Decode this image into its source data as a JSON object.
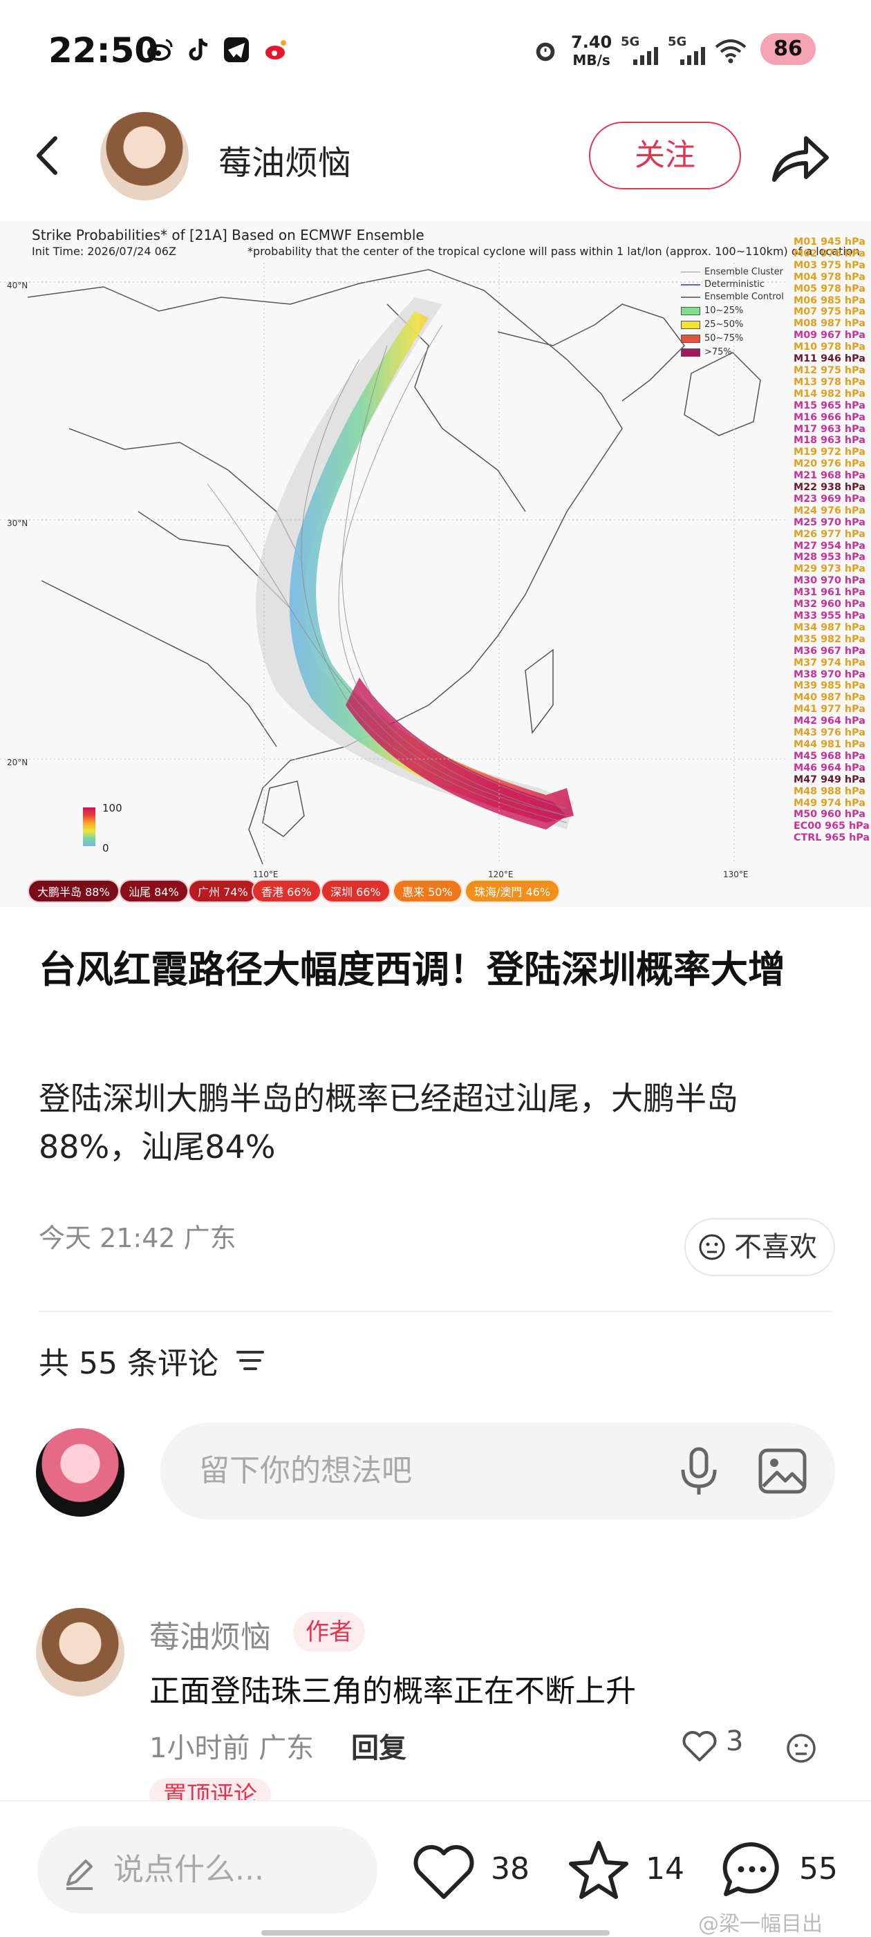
{
  "status_bar": {
    "time": "22:50",
    "net_speed_value": "7.40",
    "net_speed_unit": "MB/s",
    "signal1": "5G",
    "signal2": "5G",
    "battery": "86",
    "app_icons": [
      "weibo-icon",
      "tiktok-icon",
      "telegram-icon",
      "weibo-icon"
    ]
  },
  "header": {
    "author_name": "莓油烦恼",
    "follow_label": "关注"
  },
  "map": {
    "title": "Strike Probabilities* of [21A] Based on ECMWF Ensemble",
    "init_time": "Init Time: 2026/07/24 06Z",
    "note": "*probability that the center of the tropical cyclone will pass within 1 lat/lon (approx. 100~110km) of a location",
    "legend": [
      "Ensemble Cluster",
      "Deterministic",
      "Ensemble Control",
      "10~25%",
      "25~50%",
      "50~75%",
      ">75%"
    ],
    "legend_colors": [
      "#7fe08a",
      "#f2e23a",
      "#e8503c",
      "#a3195b"
    ],
    "lat_labels": [
      "40°N",
      "30°N",
      "20°N"
    ],
    "lon_labels": [
      "110°E",
      "120°E",
      "130°E"
    ],
    "scale_top": "100",
    "scale_bottom": "0",
    "members": [
      {
        "label": "M01 945 hPa",
        "color": "#e0a020"
      },
      {
        "label": "M02 976 hPa",
        "color": "#e0a020"
      },
      {
        "label": "M03 975 hPa",
        "color": "#e0a020"
      },
      {
        "label": "M04 978 hPa",
        "color": "#e0a020"
      },
      {
        "label": "M05 978 hPa",
        "color": "#e0a020"
      },
      {
        "label": "M06 985 hPa",
        "color": "#e0a020"
      },
      {
        "label": "M07 975 hPa",
        "color": "#e0a020"
      },
      {
        "label": "M08 987 hPa",
        "color": "#e0a020"
      },
      {
        "label": "M09 967 hPa",
        "color": "#c8329a"
      },
      {
        "label": "M10 978 hPa",
        "color": "#e0a020"
      },
      {
        "label": "M11 946 hPa",
        "color": "#6a1a2a"
      },
      {
        "label": "M12 975 hPa",
        "color": "#e0a020"
      },
      {
        "label": "M13 978 hPa",
        "color": "#e0a020"
      },
      {
        "label": "M14 982 hPa",
        "color": "#e0a020"
      },
      {
        "label": "M15 965 hPa",
        "color": "#c8329a"
      },
      {
        "label": "M16 966 hPa",
        "color": "#c8329a"
      },
      {
        "label": "M17 963 hPa",
        "color": "#c8329a"
      },
      {
        "label": "M18 963 hPa",
        "color": "#c8329a"
      },
      {
        "label": "M19 972 hPa",
        "color": "#e0a020"
      },
      {
        "label": "M20 976 hPa",
        "color": "#e0a020"
      },
      {
        "label": "M21 968 hPa",
        "color": "#c8329a"
      },
      {
        "label": "M22 938 hPa",
        "color": "#6a1a2a"
      },
      {
        "label": "M23 969 hPa",
        "color": "#c8329a"
      },
      {
        "label": "M24 976 hPa",
        "color": "#e0a020"
      },
      {
        "label": "M25 970 hPa",
        "color": "#c8329a"
      },
      {
        "label": "M26 977 hPa",
        "color": "#e0a020"
      },
      {
        "label": "M27 954 hPa",
        "color": "#c8329a"
      },
      {
        "label": "M28 953 hPa",
        "color": "#c8329a"
      },
      {
        "label": "M29 973 hPa",
        "color": "#e0a020"
      },
      {
        "label": "M30 970 hPa",
        "color": "#c8329a"
      },
      {
        "label": "M31 961 hPa",
        "color": "#c8329a"
      },
      {
        "label": "M32 960 hPa",
        "color": "#c8329a"
      },
      {
        "label": "M33 955 hPa",
        "color": "#c8329a"
      },
      {
        "label": "M34 987 hPa",
        "color": "#e0a020"
      },
      {
        "label": "M35 982 hPa",
        "color": "#e0a020"
      },
      {
        "label": "M36 967 hPa",
        "color": "#c8329a"
      },
      {
        "label": "M37 974 hPa",
        "color": "#e0a020"
      },
      {
        "label": "M38 970 hPa",
        "color": "#c8329a"
      },
      {
        "label": "M39 985 hPa",
        "color": "#e0a020"
      },
      {
        "label": "M40 987 hPa",
        "color": "#e0a020"
      },
      {
        "label": "M41 977 hPa",
        "color": "#e0a020"
      },
      {
        "label": "M42 964 hPa",
        "color": "#c8329a"
      },
      {
        "label": "M43 976 hPa",
        "color": "#e0a020"
      },
      {
        "label": "M44 981 hPa",
        "color": "#e0a020"
      },
      {
        "label": "M45 968 hPa",
        "color": "#c8329a"
      },
      {
        "label": "M46 964 hPa",
        "color": "#c8329a"
      },
      {
        "label": "M47 949 hPa",
        "color": "#6a1a2a"
      },
      {
        "label": "M48 988 hPa",
        "color": "#e0a020"
      },
      {
        "label": "M49 974 hPa",
        "color": "#e0a020"
      },
      {
        "label": "M50 960 hPa",
        "color": "#c8329a"
      },
      {
        "label": "EC00 965 hPa",
        "color": "#c8329a"
      },
      {
        "label": "CTRL 965 hPa",
        "color": "#c8329a"
      }
    ],
    "badges": [
      {
        "label": "大鹏半岛 88%",
        "color": "#7a0c1a"
      },
      {
        "label": "汕尾 84%",
        "color": "#8a0f1a"
      },
      {
        "label": "广州 74%",
        "color": "#b81a22"
      },
      {
        "label": "香港 66%",
        "color": "#e0302c"
      },
      {
        "label": "深圳 66%",
        "color": "#e0302c"
      },
      {
        "label": "惠来 50%",
        "color": "#f0781a"
      },
      {
        "label": "珠海/澳門 46%",
        "color": "#f0901a"
      }
    ]
  },
  "post": {
    "title": "台风红霞路径大幅度西调！登陆深圳概率大增",
    "body": "登陆深圳大鹏半岛的概率已经超过汕尾，大鹏半岛88%，汕尾84%",
    "meta": "今天 21:42 广东",
    "dislike_label": "不喜欢"
  },
  "comments": {
    "count_label": "共 55 条评论",
    "input_placeholder": "留下你的想法吧",
    "items": [
      {
        "name": "莓油烦恼",
        "badge": "作者",
        "text": "正面登陆珠三角的概率正在不断上升",
        "meta": "1小时前 广东",
        "reply": "回复",
        "likes": "3",
        "pinned": "置顶评论"
      }
    ]
  },
  "bottom_bar": {
    "placeholder": "说点什么...",
    "likes": "38",
    "stars": "14",
    "comments": "55",
    "watermark": "@梁一幅目出"
  }
}
